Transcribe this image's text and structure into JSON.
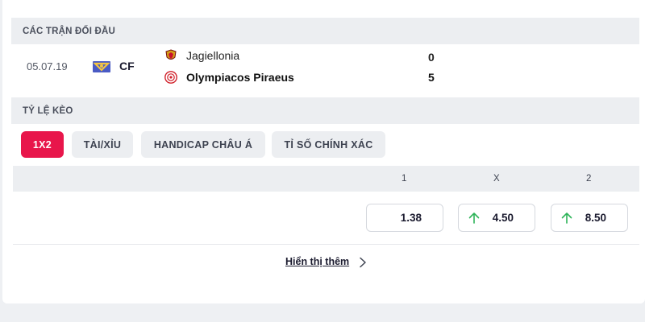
{
  "sections": {
    "head_to_head_title": "CÁC TRẬN ĐỐI ĐẦU",
    "odds_title": "TỶ LỆ KÈO"
  },
  "match": {
    "date": "05.07.19",
    "competition": "CF",
    "competition_icon": "club-friendly-flag-icon",
    "home_team": "Jagiellonia",
    "home_badge": "jagiellonia-badge-icon",
    "home_score": "0",
    "away_team": "Olympiacos Piraeus",
    "away_badge": "olympiacos-badge-icon",
    "away_score": "5"
  },
  "tabs": [
    {
      "label": "1X2",
      "active": true
    },
    {
      "label": "TÀI/XỈU",
      "active": false
    },
    {
      "label": "HANDICAP CHÂU Á",
      "active": false
    },
    {
      "label": "TỈ SỐ CHÍNH XÁC",
      "active": false
    }
  ],
  "odds": {
    "headers": [
      "1",
      "X",
      "2"
    ],
    "values": [
      {
        "value": "1.38",
        "trend": "none"
      },
      {
        "value": "4.50",
        "trend": "up"
      },
      {
        "value": "8.50",
        "trend": "up"
      }
    ],
    "up_color": "#2fb45a"
  },
  "show_more": {
    "label": "Hiển thị thêm",
    "icon": "chevron-right-icon"
  },
  "colors": {
    "accent": "#e8164b"
  }
}
